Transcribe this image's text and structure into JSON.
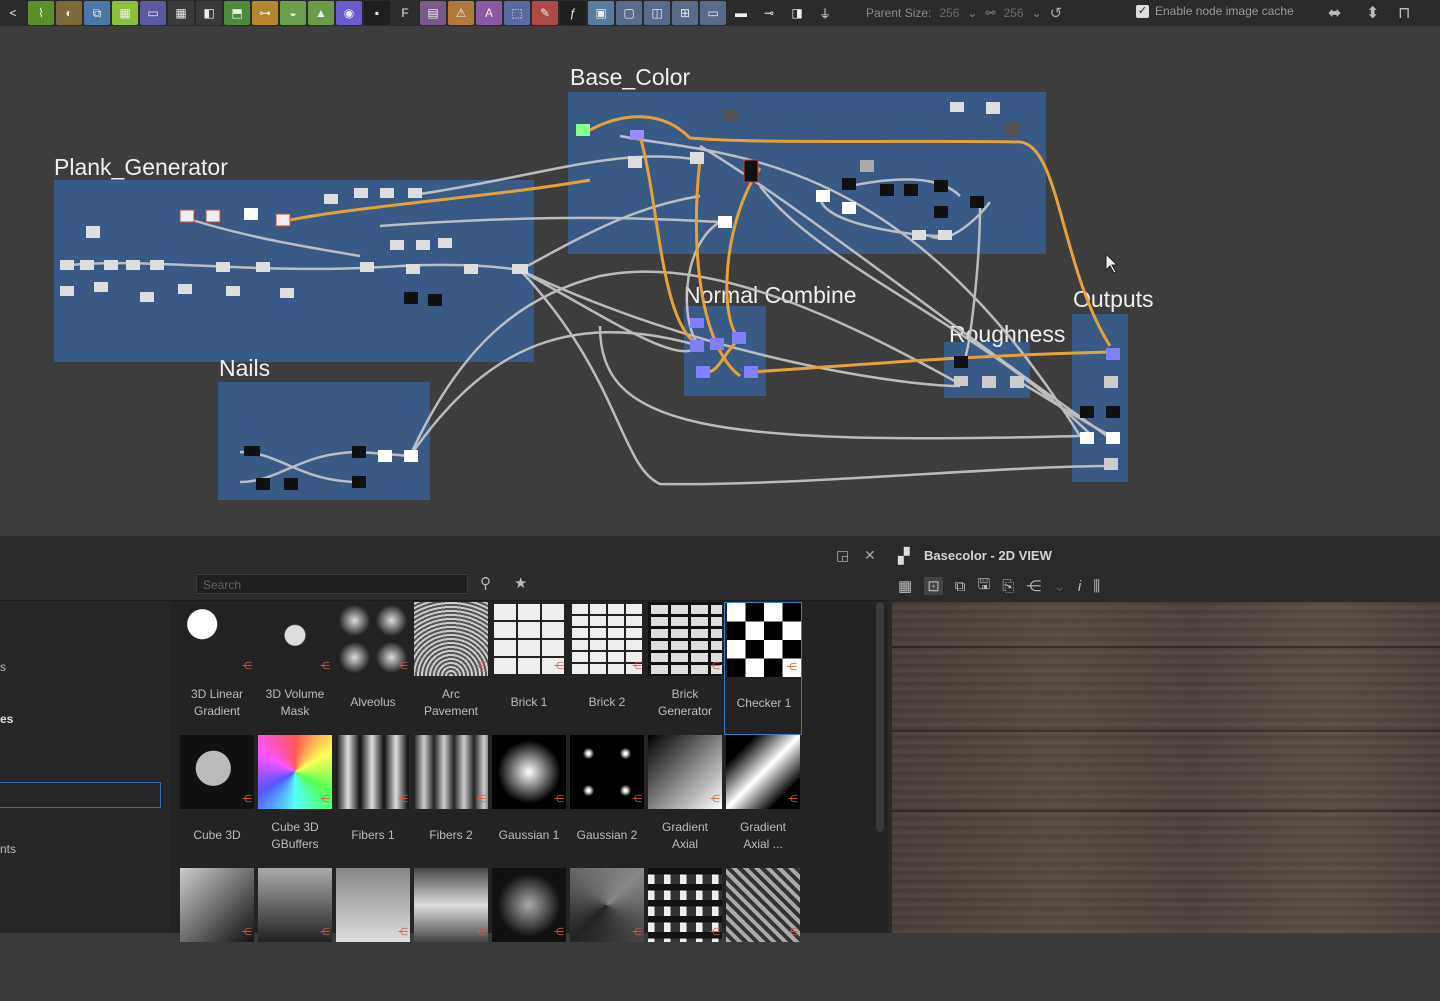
{
  "toolbar": {
    "parent_size_label": "Parent Size:",
    "parent_size_w": "256",
    "parent_size_h": "256",
    "cache_label": "Enable node image cache",
    "cache_checked": true
  },
  "graph": {
    "frames": {
      "base_color": "Base_Color",
      "plank_generator": "Plank_Generator",
      "nails": "Nails",
      "normal_combine": "Normal Combine",
      "roughness": "Roughness",
      "outputs": "Outputs"
    }
  },
  "library": {
    "search_placeholder": "Search",
    "side_items": [
      "s",
      "es",
      "nts"
    ],
    "items": [
      {
        "label_1": "3D Linear",
        "label_2": "Gradient",
        "thumb": "cube-dark"
      },
      {
        "label_1": "3D Volume",
        "label_2": "Mask",
        "thumb": "cube-small"
      },
      {
        "label_1": "Alveolus",
        "label_2": "",
        "thumb": "alveolus"
      },
      {
        "label_1": "Arc",
        "label_2": "Pavement",
        "thumb": "arc"
      },
      {
        "label_1": "Brick 1",
        "label_2": "",
        "thumb": "brick1"
      },
      {
        "label_1": "Brick 2",
        "label_2": "",
        "thumb": "brick2"
      },
      {
        "label_1": "Brick",
        "label_2": "Generator",
        "thumb": "brickgen"
      },
      {
        "label_1": "Checker 1",
        "label_2": "",
        "thumb": "checker",
        "selected": true
      },
      {
        "label_1": "Cube 3D",
        "label_2": "",
        "thumb": "cube3d"
      },
      {
        "label_1": "Cube 3D",
        "label_2": "GBuffers",
        "thumb": "cubergb"
      },
      {
        "label_1": "Fibers 1",
        "label_2": "",
        "thumb": "fibers1"
      },
      {
        "label_1": "Fibers 2",
        "label_2": "",
        "thumb": "fibers2"
      },
      {
        "label_1": "Gaussian 1",
        "label_2": "",
        "thumb": "gauss1"
      },
      {
        "label_1": "Gaussian 2",
        "label_2": "",
        "thumb": "gauss2"
      },
      {
        "label_1": "Gradient",
        "label_2": "Axial",
        "thumb": "gradaxial"
      },
      {
        "label_1": "Gradient",
        "label_2": "Axial ...",
        "thumb": "gradaxial2"
      },
      {
        "label_1": "",
        "label_2": "",
        "thumb": "grad-corner"
      },
      {
        "label_1": "",
        "label_2": "",
        "thumb": "grad-v"
      },
      {
        "label_1": "",
        "label_2": "",
        "thumb": "grad-h"
      },
      {
        "label_1": "",
        "label_2": "",
        "thumb": "grad-h2"
      },
      {
        "label_1": "",
        "label_2": "",
        "thumb": "radial"
      },
      {
        "label_1": "",
        "label_2": "",
        "thumb": "pyramid"
      },
      {
        "label_1": "",
        "label_2": "",
        "thumb": "weave"
      },
      {
        "label_1": "",
        "label_2": "",
        "thumb": "weave2"
      }
    ]
  },
  "view2d": {
    "title": "Basecolor - 2D VIEW"
  },
  "colors": {
    "frame": "#3a5a86",
    "wire_orange": "#e6a23a",
    "wire_gray": "#c9c9c9",
    "accent": "#3c7dc8"
  }
}
